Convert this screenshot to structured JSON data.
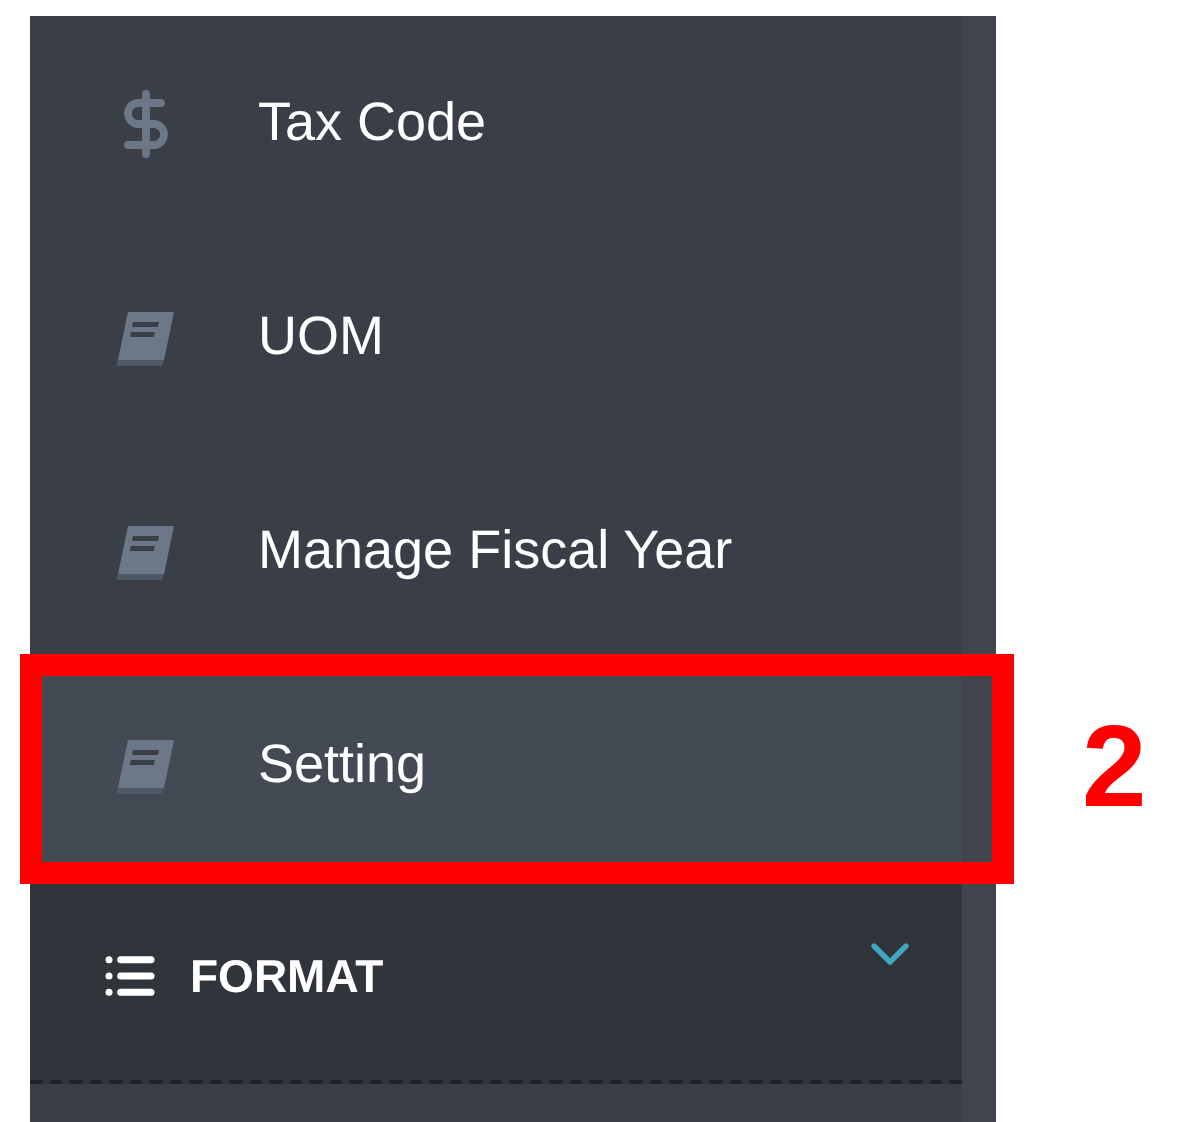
{
  "sidebar": {
    "items": [
      {
        "label": "Tax Code",
        "kind": "dollar",
        "selected": false
      },
      {
        "label": "UOM",
        "kind": "book",
        "selected": false
      },
      {
        "label": "Manage Fiscal Year",
        "kind": "book",
        "selected": false
      },
      {
        "label": "Setting",
        "kind": "book",
        "selected": true
      }
    ],
    "section": {
      "label": "FORMAT",
      "expanded": false
    }
  },
  "annotation": {
    "label": "2"
  }
}
